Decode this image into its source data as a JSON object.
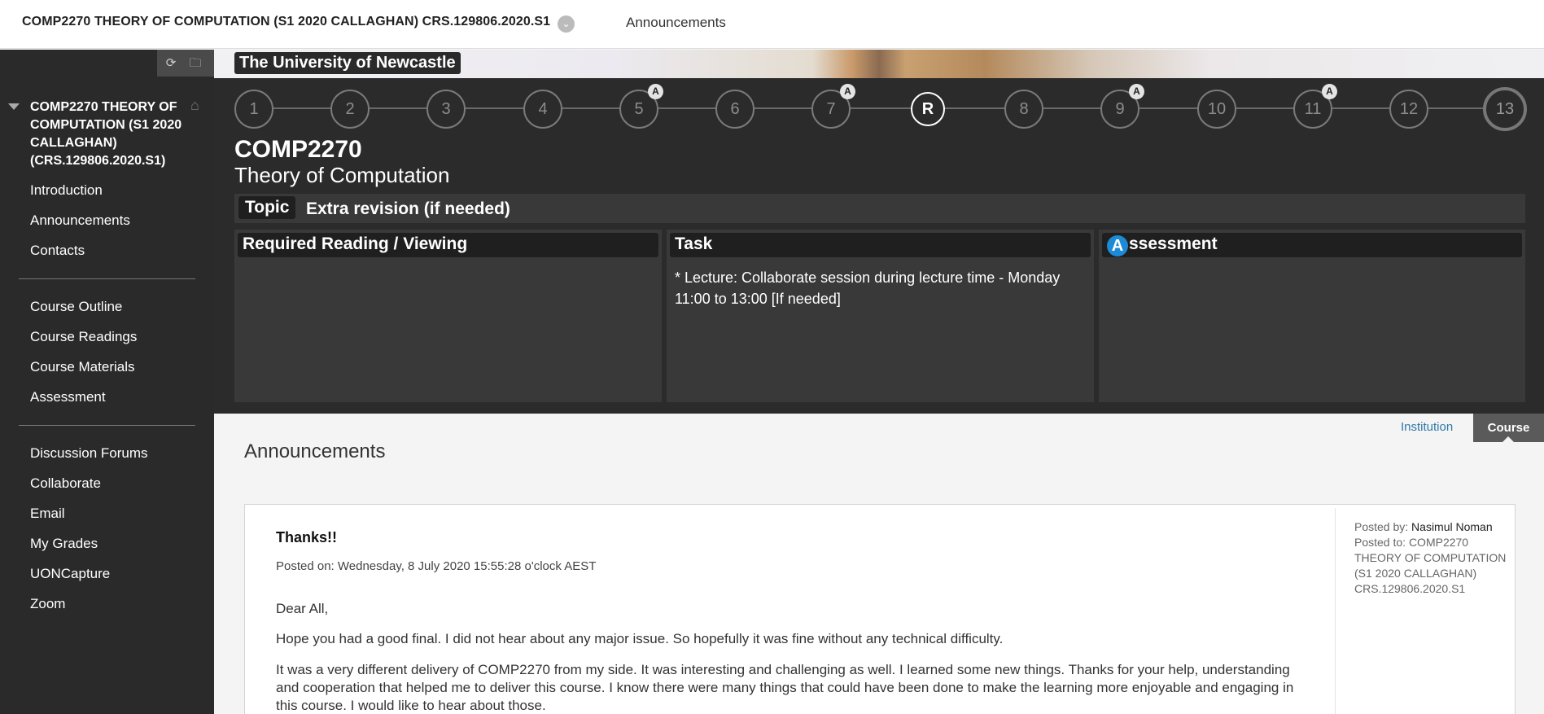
{
  "header": {
    "course_title": "COMP2270 THEORY OF COMPUTATION (S1 2020 CALLAGHAN) CRS.129806.2020.S1",
    "breadcrumb": "Announcements"
  },
  "sidebar": {
    "course_name": "COMP2270 THEORY OF COMPUTATION (S1 2020 CALLAGHAN) (CRS.129806.2020.S1)",
    "group1": [
      "Introduction",
      "Announcements",
      "Contacts"
    ],
    "group2": [
      "Course Outline",
      "Course Readings",
      "Course Materials",
      "Assessment"
    ],
    "group3": [
      "Discussion Forums",
      "Collaborate",
      "Email",
      "My Grades",
      "UONCapture",
      "Zoom"
    ]
  },
  "banner": {
    "university": "The University of Newcastle"
  },
  "timeline": {
    "weeks": [
      "1",
      "2",
      "3",
      "4",
      "5",
      "6",
      "7",
      "R",
      "8",
      "9",
      "10",
      "11",
      "12",
      "13"
    ],
    "badge_label": "A",
    "badged_weeks": [
      "5",
      "7",
      "9",
      "11"
    ],
    "current": "R"
  },
  "course": {
    "code": "COMP2270",
    "name": "Theory of Computation"
  },
  "topic": {
    "label": "Topic",
    "value": "Extra revision (if needed)"
  },
  "columns": {
    "reading": {
      "title": "Required Reading / Viewing",
      "body": ""
    },
    "task": {
      "title": "Task",
      "body": "* Lecture: Collaborate session during lecture time - Monday 11:00 to 13:00 [If needed]"
    },
    "assessment": {
      "badge": "A",
      "title": "ssessment",
      "body": ""
    }
  },
  "tabs": {
    "institution": "Institution",
    "course": "Course"
  },
  "announcements": {
    "heading": "Announcements",
    "post": {
      "title": "Thanks!!",
      "posted_on": "Posted on: Wednesday, 8 July 2020 15:55:28 o'clock AEST",
      "paragraphs": [
        "Dear All,",
        "Hope you had a good final. I did not hear about any major issue. So hopefully it was fine without any technical difficulty.",
        "It was a very different delivery of COMP2270 from my side. It was interesting and challenging as well. I learned some new things. Thanks for your help, understanding and cooperation that helped me to deliver this course. I know there were many things that could have been done to make the learning more enjoyable and engaging in this course. I would like to hear about those."
      ],
      "posted_by_label": "Posted by:",
      "posted_by": "Nasimul Noman",
      "posted_to_label": "Posted to:",
      "posted_to": "COMP2270 THEORY OF COMPUTATION (S1 2020 CALLAGHAN) CRS.129806.2020.S1"
    }
  },
  "icons": {
    "refresh": "refresh-icon",
    "folder": "folder-icon",
    "home": "home-icon",
    "chevron": "chevron-down-icon"
  }
}
